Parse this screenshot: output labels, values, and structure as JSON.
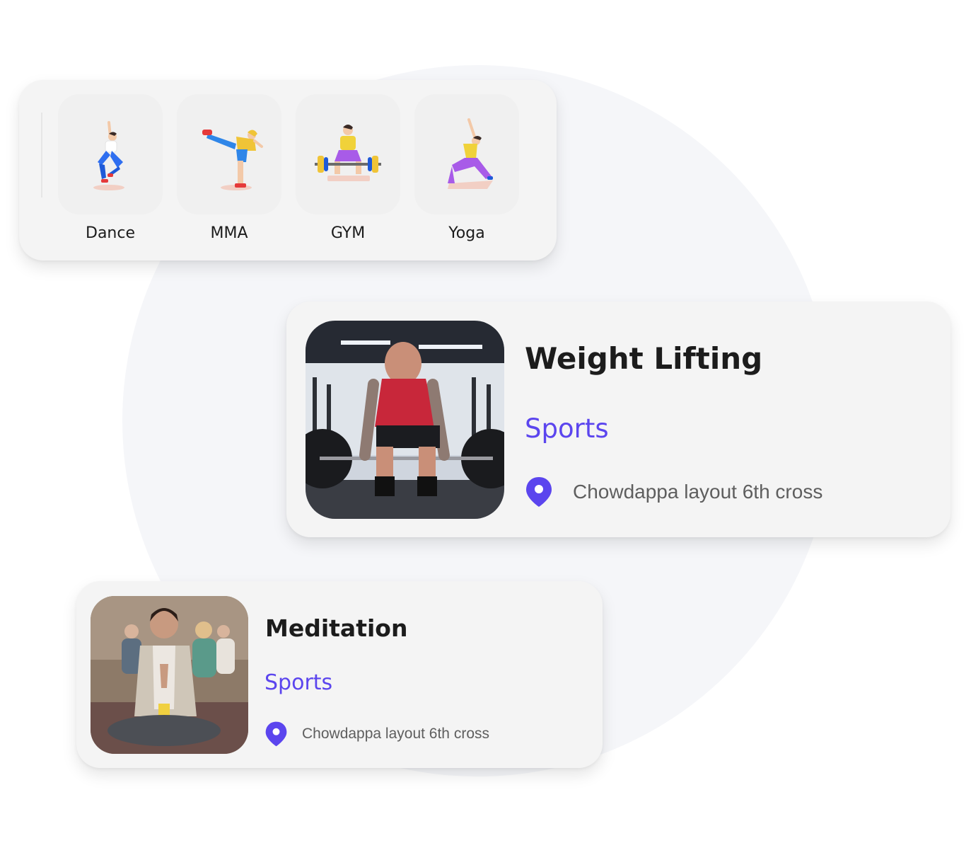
{
  "categories": [
    {
      "label": "Dance"
    },
    {
      "label": "MMA"
    },
    {
      "label": "GYM"
    },
    {
      "label": "Yoga"
    }
  ],
  "events": [
    {
      "title": "Weight Lifting",
      "category": "Sports",
      "location": "Chowdappa layout 6th cross"
    },
    {
      "title": "Meditation",
      "category": "Sports",
      "location": "Chowdappa layout 6th cross"
    }
  ],
  "colors": {
    "accent": "#5b45ee",
    "card": "#f4f4f4",
    "background_circle": "#f5f6f9"
  },
  "icons": {
    "location": "map-pin-icon"
  }
}
